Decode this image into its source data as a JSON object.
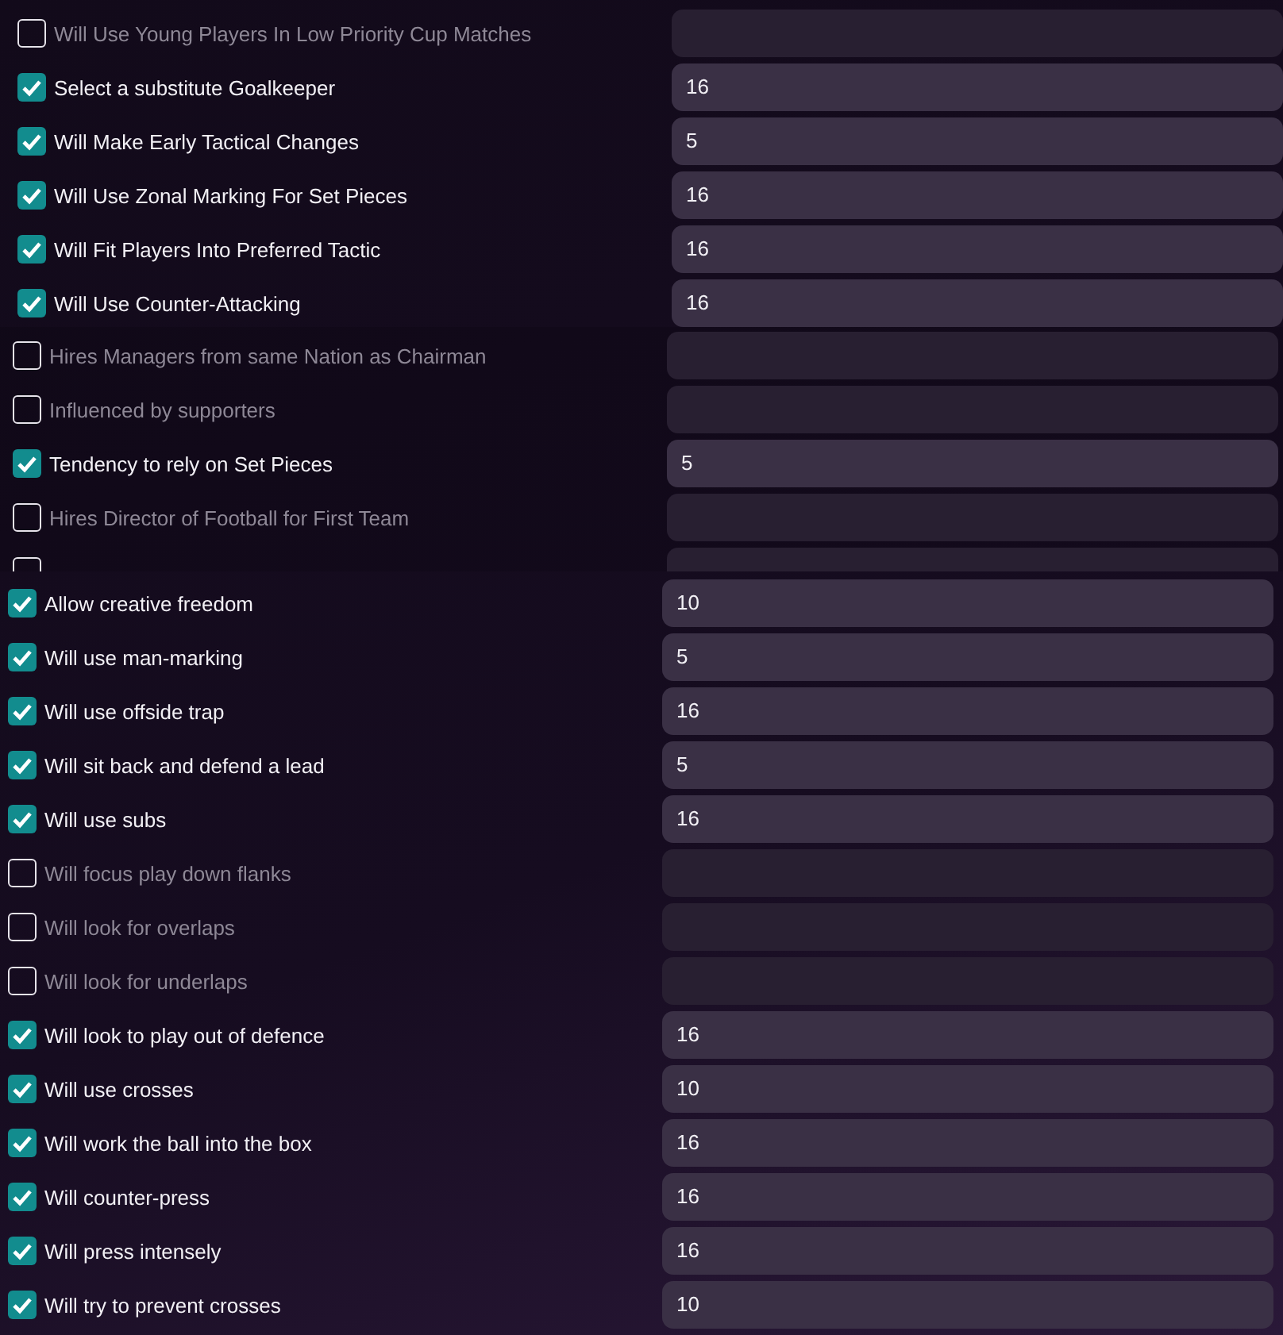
{
  "panels": [
    {
      "rows": [
        {
          "label": "Will Use Young Players In Low Priority Cup Matches",
          "checked": false,
          "value": ""
        },
        {
          "label": "Select a substitute Goalkeeper",
          "checked": true,
          "value": "16"
        },
        {
          "label": "Will Make Early Tactical Changes",
          "checked": true,
          "value": "5"
        },
        {
          "label": "Will Use Zonal Marking For Set Pieces",
          "checked": true,
          "value": "16"
        },
        {
          "label": "Will Fit Players Into Preferred Tactic",
          "checked": true,
          "value": "16"
        },
        {
          "label": "Will Use Counter-Attacking",
          "checked": true,
          "value": "16"
        }
      ]
    },
    {
      "rows": [
        {
          "label": "Hires Managers from same Nation as Chairman",
          "checked": false,
          "value": ""
        },
        {
          "label": "Influenced by supporters",
          "checked": false,
          "value": ""
        },
        {
          "label": "Tendency to rely on Set Pieces",
          "checked": true,
          "value": "5"
        },
        {
          "label": "Hires Director of Football for First Team",
          "checked": false,
          "value": ""
        },
        {
          "checked": false,
          "value": ""
        }
      ]
    },
    {
      "rows": [
        {
          "label": "Allow creative freedom",
          "checked": true,
          "value": "10"
        },
        {
          "label": "Will use man-marking",
          "checked": true,
          "value": "5"
        },
        {
          "label": "Will use offside trap",
          "checked": true,
          "value": "16"
        },
        {
          "label": "Will sit back and defend a lead",
          "checked": true,
          "value": "5"
        },
        {
          "label": "Will use subs",
          "checked": true,
          "value": "16"
        },
        {
          "label": "Will focus play down flanks",
          "checked": false,
          "value": ""
        },
        {
          "label": "Will look for overlaps",
          "checked": false,
          "value": ""
        },
        {
          "label": "Will look for underlaps",
          "checked": false,
          "value": ""
        },
        {
          "label": "Will look to play out of defence",
          "checked": true,
          "value": "16"
        },
        {
          "label": "Will use crosses",
          "checked": true,
          "value": "10"
        },
        {
          "label": "Will work the ball into the box",
          "checked": true,
          "value": "16"
        },
        {
          "label": "Will counter-press",
          "checked": true,
          "value": "16"
        },
        {
          "label": "Will press intensely",
          "checked": true,
          "value": "16"
        },
        {
          "label": "Will try to prevent crosses",
          "checked": true,
          "value": "10"
        }
      ]
    }
  ]
}
